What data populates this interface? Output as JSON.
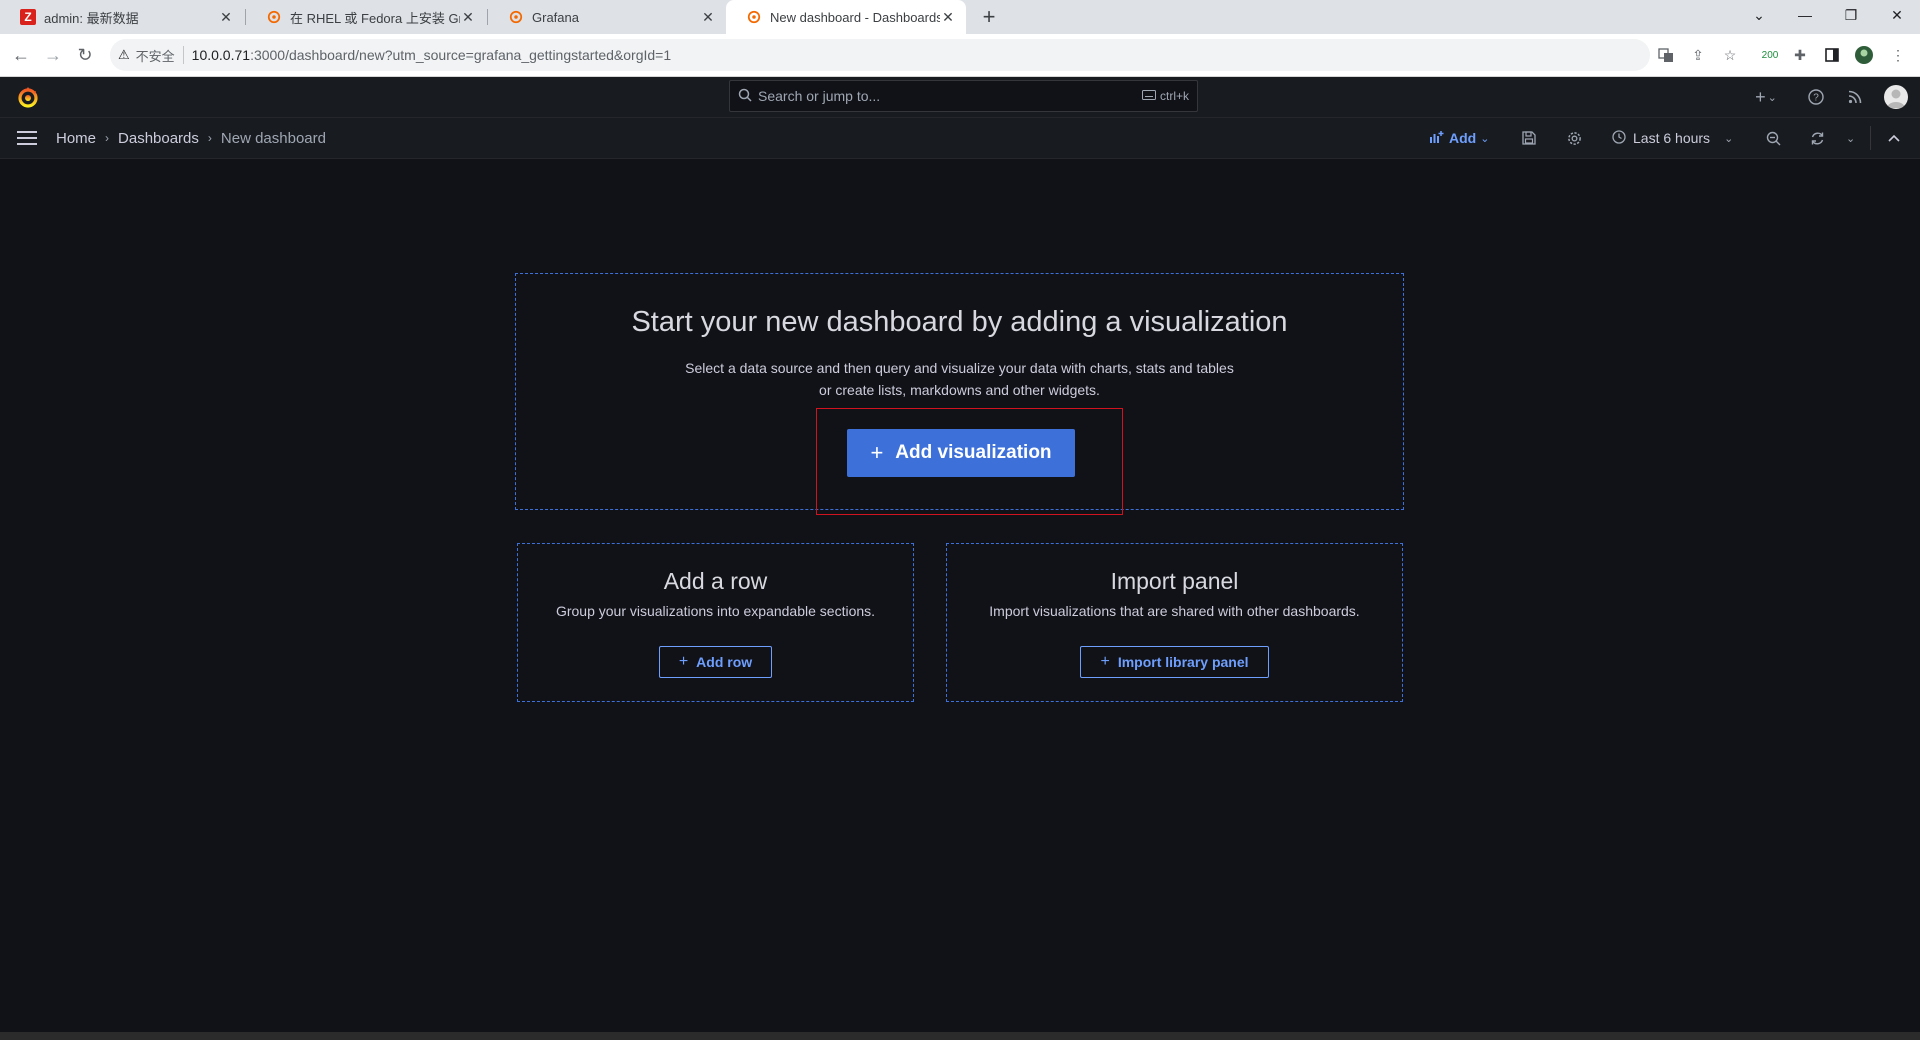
{
  "browser": {
    "tabs": [
      {
        "title": "admin: 最新数据",
        "favicon": "zabbix-icon"
      },
      {
        "title": "在 RHEL 或 Fedora 上安装 Grafana",
        "favicon": "grafana-icon"
      },
      {
        "title": "Grafana",
        "favicon": "grafana-icon"
      },
      {
        "title": "New dashboard - Dashboards",
        "favicon": "grafana-icon",
        "active": true
      }
    ],
    "address": {
      "security_label": "不安全",
      "host": "10.0.0.71",
      "rest": ":3000/dashboard/new?utm_source=grafana_gettingstarted&orgId=1"
    },
    "extension_badge": "200"
  },
  "grafana": {
    "search": {
      "placeholder": "Search or jump to...",
      "shortcut": "ctrl+k"
    },
    "breadcrumbs": {
      "home": "Home",
      "dashboards": "Dashboards",
      "current": "New dashboard"
    },
    "toolbar": {
      "add_label": "Add",
      "time_range": "Last 6 hours"
    },
    "hero": {
      "title": "Start your new dashboard by adding a visualization",
      "desc_line1": "Select a data source and then query and visualize your data with charts, stats and tables",
      "desc_line2": "or create lists, markdowns and other widgets.",
      "button": "Add visualization"
    },
    "row_card": {
      "title": "Add a row",
      "desc": "Group your visualizations into expandable sections.",
      "button": "Add row"
    },
    "import_card": {
      "title": "Import panel",
      "desc": "Import visualizations that are shared with other dashboards.",
      "button": "Import library panel"
    },
    "colors": {
      "primary": "#3d71d9",
      "link": "#6e9fff",
      "background": "#111217",
      "highlight": "#d0131e"
    }
  }
}
